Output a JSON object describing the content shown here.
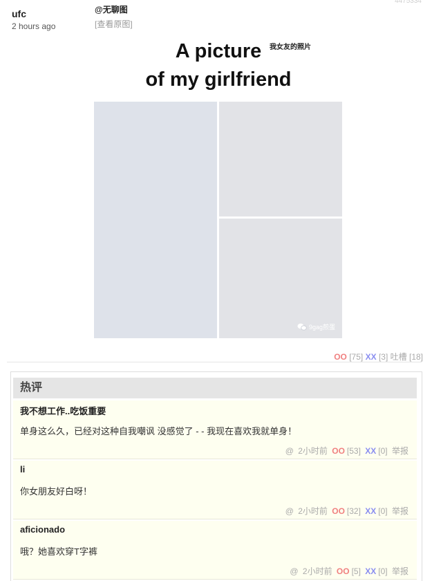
{
  "post": {
    "id": "4475334",
    "author": "ufc",
    "time": "2 hours ago",
    "source": "@无聊图",
    "view_original": "[查看原图]",
    "image": {
      "title_line1": "A picture",
      "title_line2": "of my girlfriend",
      "caption": "我女友的照片",
      "watermark": "9gag煎蛋"
    },
    "votes": {
      "oo_label": "OO",
      "oo_count": "[75]",
      "xx_label": "XX",
      "xx_count": "[3]",
      "tucao_label": "吐槽",
      "tucao_count": "[18]"
    }
  },
  "hot_comments": {
    "title": "热评",
    "items": [
      {
        "name": "我不想工作..吃饭重要",
        "text": "单身这么久，已经对这种自我嘲讽 没感觉了 - - 我现在喜欢我就单身！",
        "at": "@",
        "time": "2小时前",
        "oo_label": "OO",
        "oo_count": "[53]",
        "xx_label": "XX",
        "xx_count": "[0]",
        "report": "举报"
      },
      {
        "name": "li",
        "text": "你女朋友好白呀！",
        "at": "@",
        "time": "2小时前",
        "oo_label": "OO",
        "oo_count": "[32]",
        "xx_label": "XX",
        "xx_count": "[0]",
        "report": "举报"
      },
      {
        "name": "aficionado",
        "text": "哦？她喜欢穿T字裤",
        "at": "@",
        "time": "2小时前",
        "oo_label": "OO",
        "oo_count": "[5]",
        "xx_label": "XX",
        "xx_count": "[0]",
        "report": "举报"
      }
    ]
  }
}
